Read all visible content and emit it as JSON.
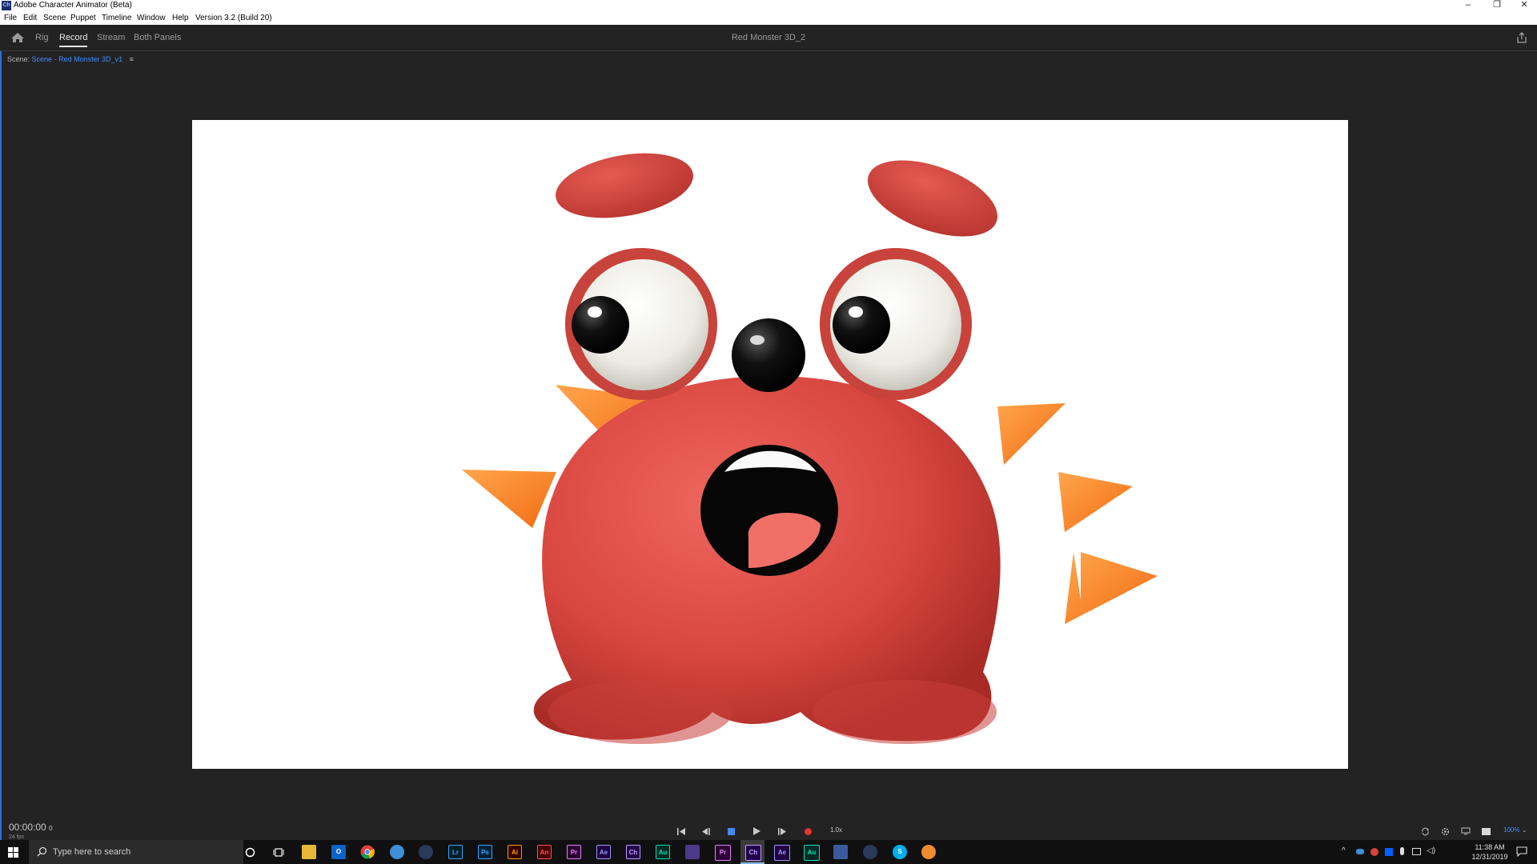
{
  "window": {
    "app_title": "Adobe Character Animator (Beta)",
    "app_icon_text": "Ch",
    "minimize": "–",
    "restore": "❐",
    "close": "✕"
  },
  "menu": [
    "File",
    "Edit",
    "Scene",
    "Puppet",
    "Timeline",
    "Window",
    "Help",
    "Version 3.2 (Build 20)"
  ],
  "workspace": {
    "tabs": [
      "Rig",
      "Record",
      "Stream",
      "Both Panels"
    ],
    "active_tab": "Record",
    "document_title": "Red Monster 3D_2"
  },
  "scene": {
    "label_prefix": "Scene:",
    "scene_name": "Scene - Red Monster 3D_v1",
    "menu_glyph": "≡"
  },
  "transport": {
    "timecode": "00:00:00",
    "timecode_suffix": "0",
    "fps": "24 fps",
    "speed": "1.0x",
    "zoom": "100%"
  },
  "taskbar": {
    "search_placeholder": "Type here to search",
    "apps": [
      {
        "name": "Lr",
        "bg": "#001d26",
        "fg": "#31a8ff"
      },
      {
        "name": "Ps",
        "bg": "#001e36",
        "fg": "#31a8ff"
      },
      {
        "name": "Ai",
        "bg": "#330000",
        "fg": "#ff9a00"
      },
      {
        "name": "An",
        "bg": "#470000",
        "fg": "#ff4f4f"
      },
      {
        "name": "Pr",
        "bg": "#2a0030",
        "fg": "#e77cff"
      },
      {
        "name": "Ae",
        "bg": "#1f0040",
        "fg": "#9999ff"
      },
      {
        "name": "Ch",
        "bg": "#20004a",
        "fg": "#c89cff"
      },
      {
        "name": "Au",
        "bg": "#002a22",
        "fg": "#00e4bb"
      }
    ],
    "clock_time": "11:38 AM",
    "clock_date": "12/31/2019"
  },
  "colors": {
    "accent": "#3f8cff",
    "panel_bg": "#232323",
    "stage_bg": "#ffffff"
  }
}
